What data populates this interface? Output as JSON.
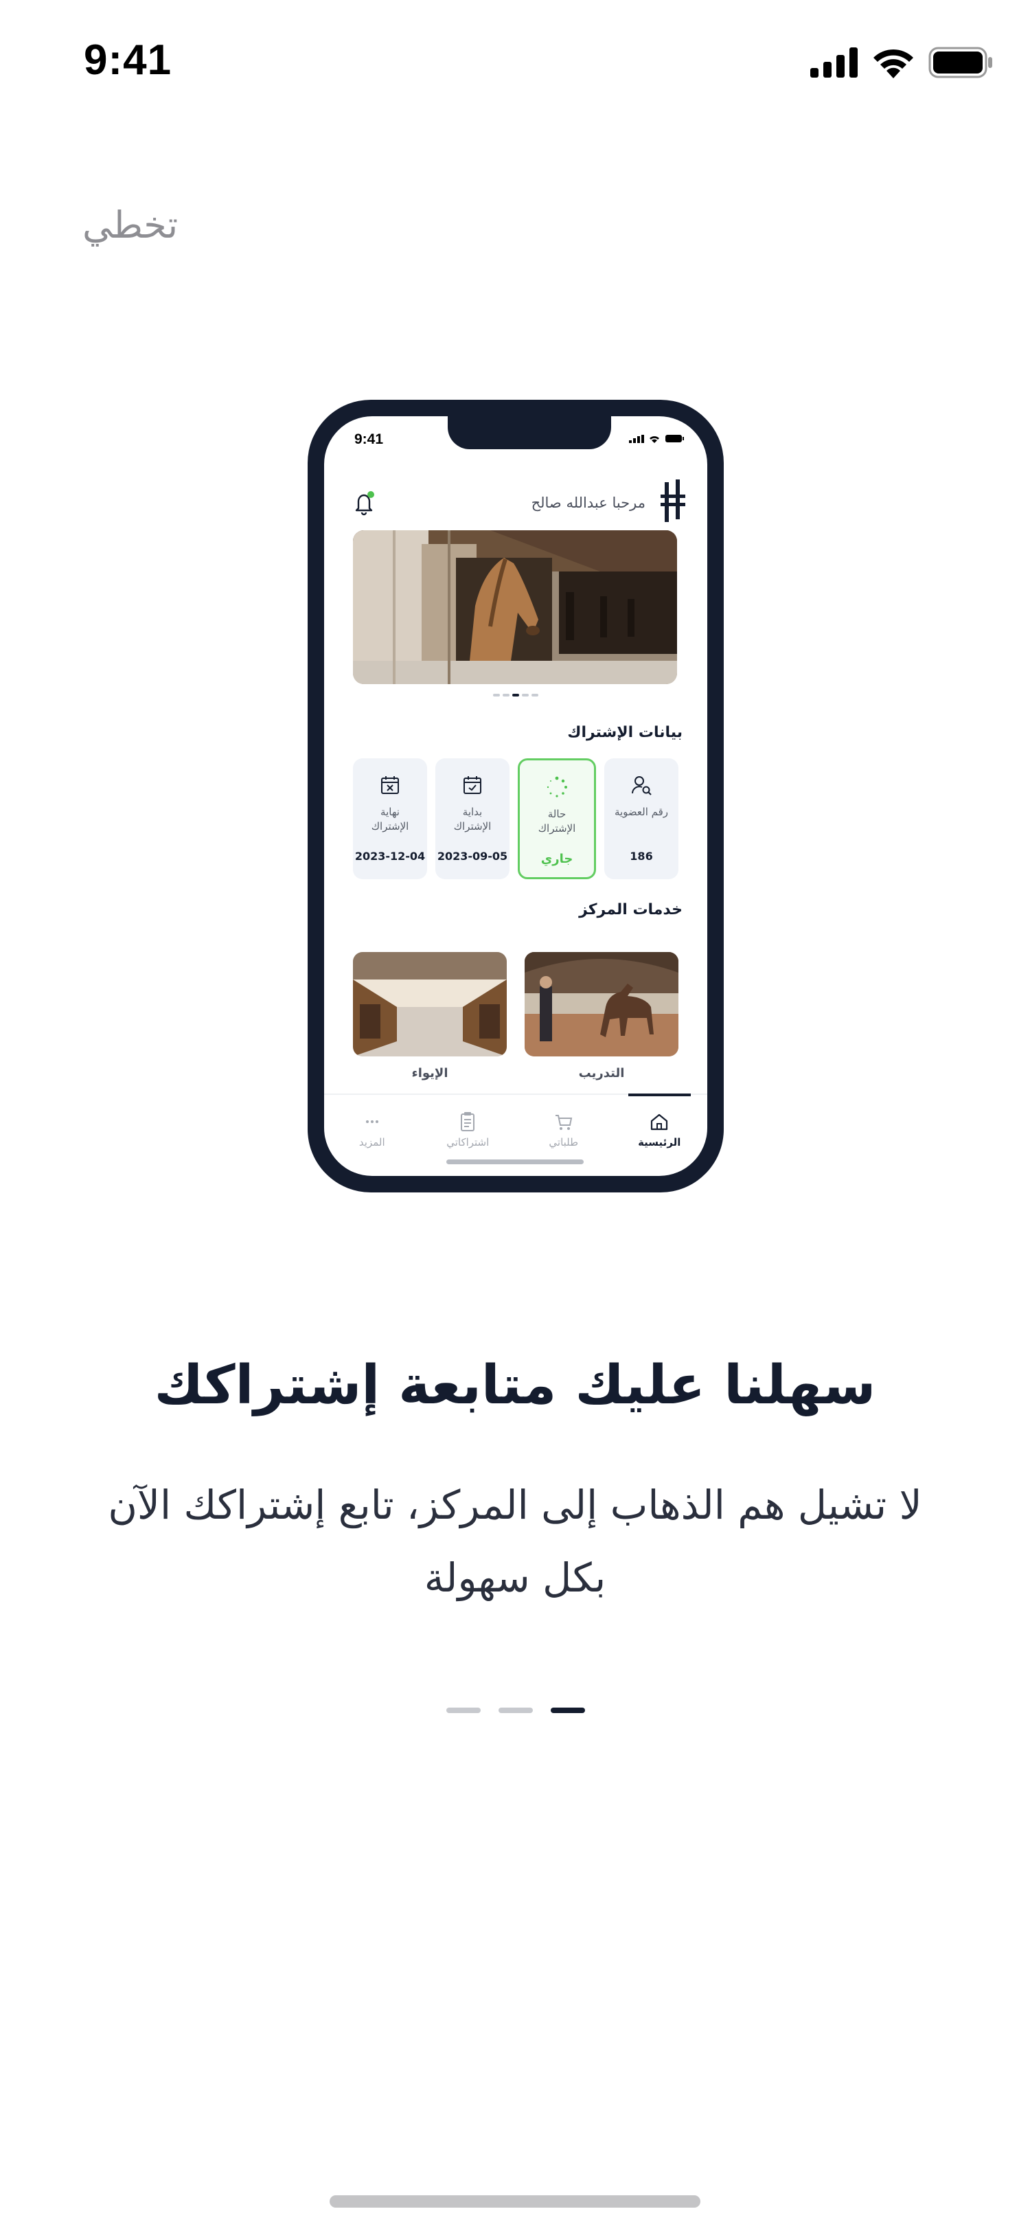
{
  "status_bar": {
    "time": "9:41"
  },
  "skip_label": "تخطي",
  "mockup": {
    "time": "9:41",
    "greeting": "مرحبا عبدالله صالح",
    "carousel_pages": 5,
    "carousel_active": 2,
    "subscription_title": "بيانات الإشتراك",
    "cards": [
      {
        "label": "رقم العضوية",
        "value": "186",
        "icon": "user-search-icon"
      },
      {
        "label": "حالة الإشتراك",
        "value": "جاري",
        "icon": "spinner-icon"
      },
      {
        "label": "بداية الإشتراك",
        "value": "2023-09-05",
        "icon": "calendar-check-icon"
      },
      {
        "label": "نهاية الإشتراك",
        "value": "2023-12-04",
        "icon": "calendar-x-icon"
      }
    ],
    "services_title": "خدمات المركز",
    "services": [
      {
        "label": "التدريب",
        "image": "horse-training-photo"
      },
      {
        "label": "الإيواء",
        "image": "stable-aisle-photo"
      }
    ],
    "nav": [
      {
        "label": "الرئيسية",
        "icon": "home-icon",
        "active": true
      },
      {
        "label": "طلباتي",
        "icon": "cart-icon",
        "active": false
      },
      {
        "label": "اشتراكاتي",
        "icon": "clipboard-icon",
        "active": false
      },
      {
        "label": "المزيد",
        "icon": "more-icon",
        "active": false
      }
    ]
  },
  "headline": "سهلنا عليك متابعة إشتراكك",
  "description": "لا تشيل هم الذهاب إلى المركز، تابع إشتراكك الآن بكل سهولة",
  "pager": {
    "count": 3,
    "active_index": 2
  },
  "colors": {
    "primary": "#141c2e",
    "accent_green": "#63cd62",
    "muted": "#8e8e93"
  }
}
